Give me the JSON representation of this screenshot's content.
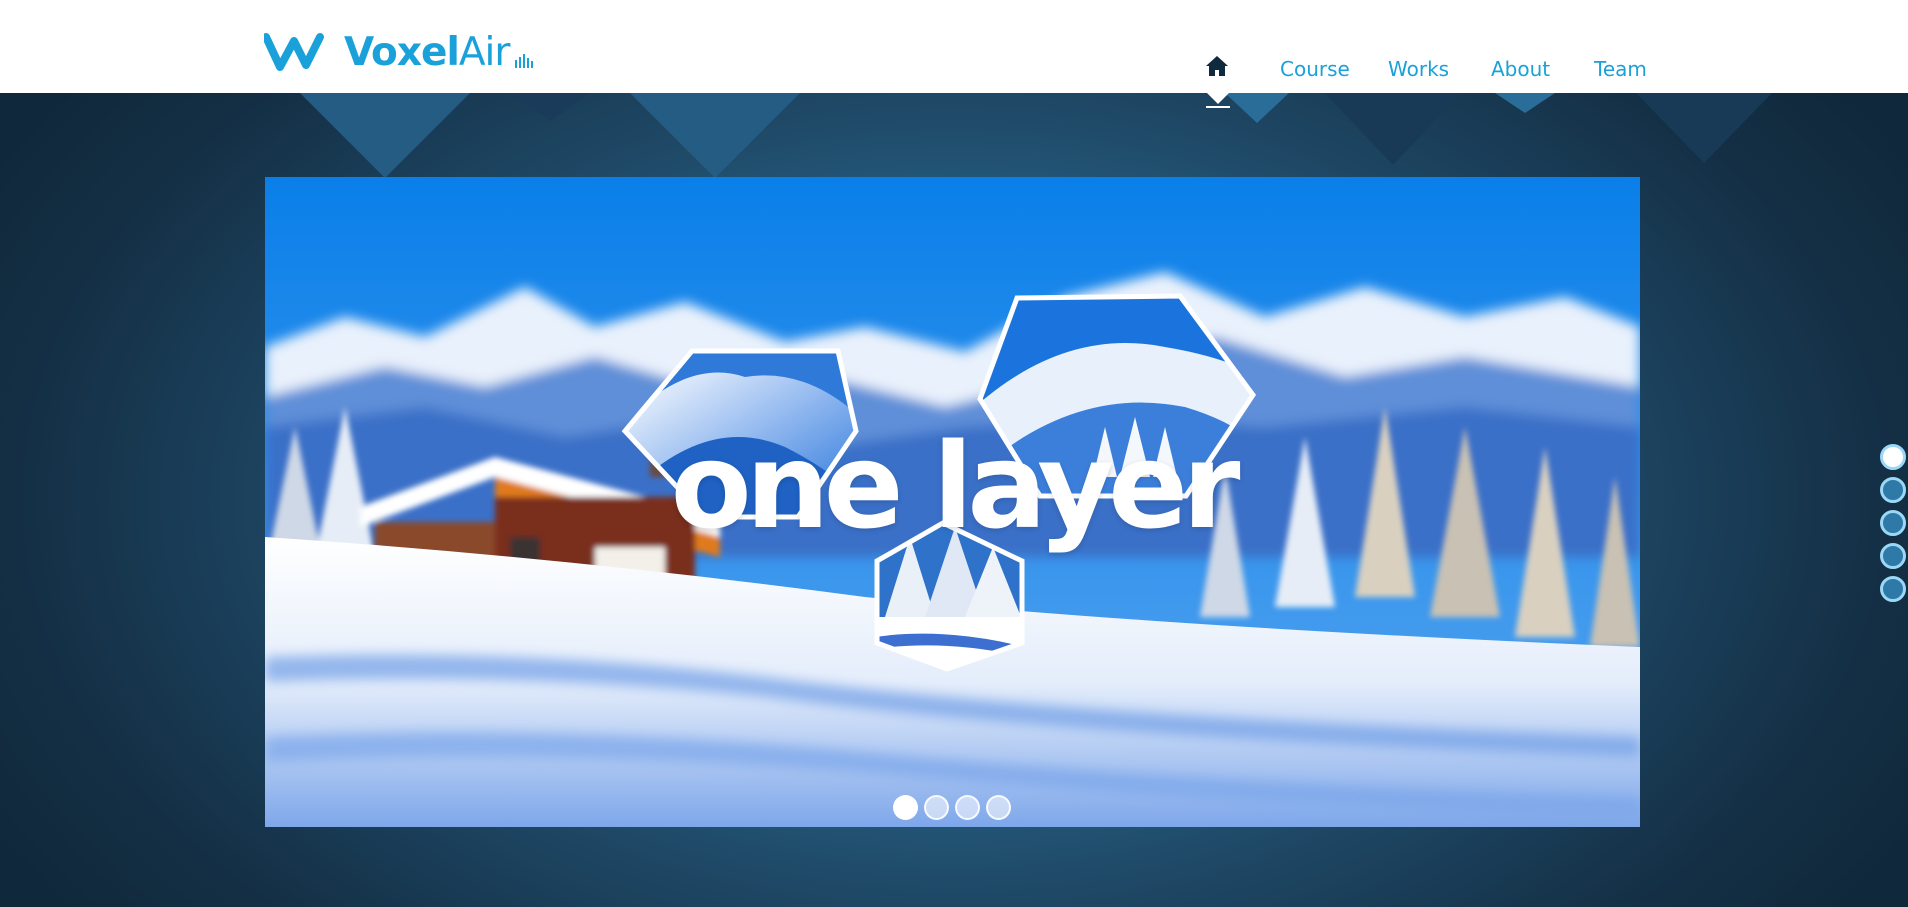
{
  "brand": {
    "name_bold": "Voxel",
    "name_light": "Air",
    "accent_color": "#1aa1da"
  },
  "nav": {
    "home_icon": "home-icon",
    "items": [
      {
        "label": "Course"
      },
      {
        "label": "Works"
      },
      {
        "label": "About"
      },
      {
        "label": "Team"
      }
    ],
    "active": "home"
  },
  "slider": {
    "title": "one layer",
    "dot_count": 4,
    "active_dot": 0
  },
  "page_nav": {
    "dot_count": 5,
    "active_dot": 0
  }
}
